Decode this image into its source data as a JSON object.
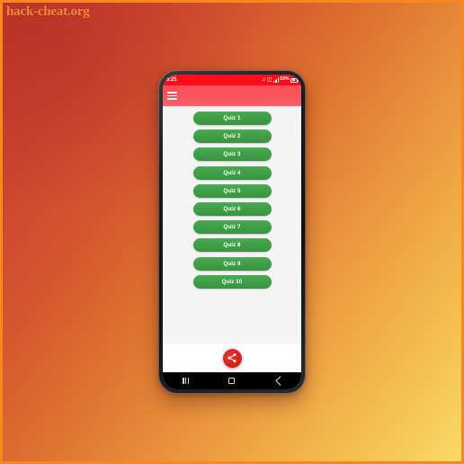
{
  "watermark": {
    "text": "hack-cheat.org"
  },
  "colors": {
    "background_start": "#c0392b",
    "background_end": "#f9d96a",
    "background_border": "#f7871f",
    "status_bar": "#fc0d1b",
    "toolbar": "#f9545d",
    "quiz_button": "#3f9e47",
    "quiz_button_text": "#ffffff",
    "fab": "#d4231d",
    "content_background": "#f4f4f4",
    "navbar": "#000000",
    "watermark_text": "#f08a33"
  },
  "phone": {
    "status_bar": {
      "time": "5:25",
      "battery_percent": "53%",
      "icons": [
        "vibrate-icon",
        "sim-icon",
        "signal-bars-icon",
        "battery-icon"
      ]
    },
    "toolbar": {
      "menu_icon": "hamburger-menu-icon",
      "title": ""
    },
    "content": {
      "quiz_buttons": [
        {
          "label": "Quiz 1"
        },
        {
          "label": "Quiz 2"
        },
        {
          "label": "Quiz 3"
        },
        {
          "label": "Quiz 4"
        },
        {
          "label": "Quiz 5"
        },
        {
          "label": "Quiz 6"
        },
        {
          "label": "Quiz 7"
        },
        {
          "label": "Quiz 8"
        },
        {
          "label": "Quiz 9"
        },
        {
          "label": "Quiz 10"
        }
      ]
    },
    "fab": {
      "icon": "share-icon",
      "label": "Share"
    },
    "navbar": {
      "buttons": [
        {
          "name": "recents",
          "icon": "recents-icon"
        },
        {
          "name": "home",
          "icon": "home-icon"
        },
        {
          "name": "back",
          "icon": "back-chevron-icon"
        }
      ]
    }
  }
}
